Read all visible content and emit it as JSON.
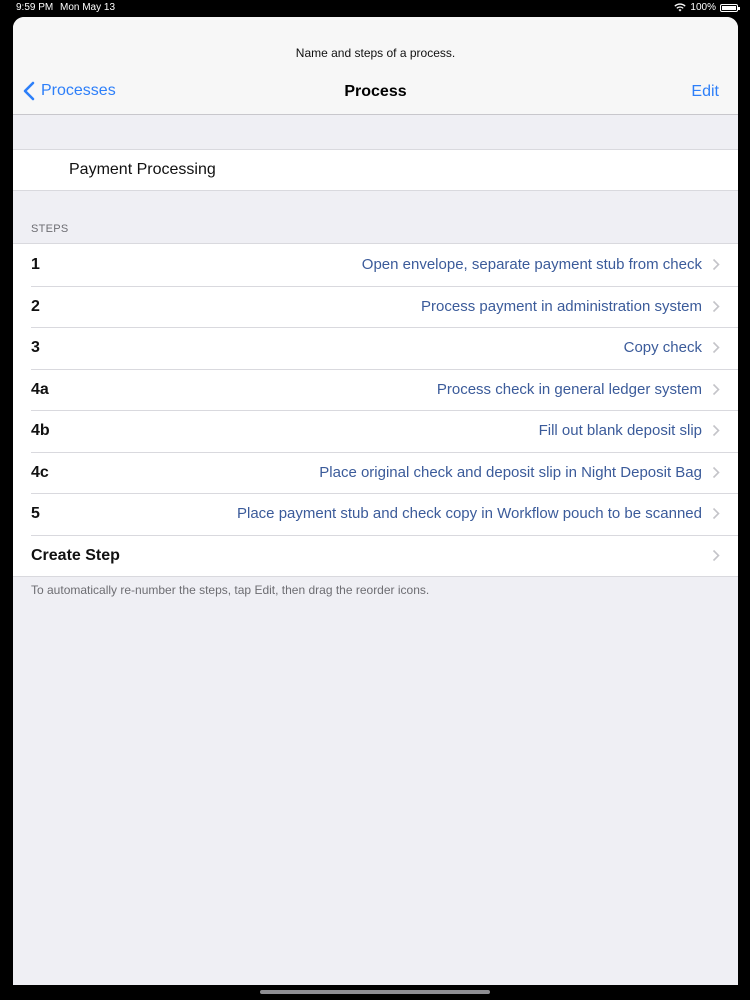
{
  "status_bar": {
    "time": "9:59 PM",
    "date": "Mon May 13",
    "battery": "100%"
  },
  "nav": {
    "prompt": "Name and steps of a process.",
    "back_label": "Processes",
    "title": "Process",
    "edit_label": "Edit"
  },
  "process_name": "Payment Processing",
  "steps_header": "STEPS",
  "steps": [
    {
      "number": "1",
      "description": "Open envelope, separate payment stub from check"
    },
    {
      "number": "2",
      "description": "Process payment in administration system"
    },
    {
      "number": "3",
      "description": "Copy check"
    },
    {
      "number": "4a",
      "description": "Process check in general ledger system"
    },
    {
      "number": "4b",
      "description": "Fill out blank deposit slip"
    },
    {
      "number": "4c",
      "description": "Place original check and deposit slip in Night Deposit Bag"
    },
    {
      "number": "5",
      "description": "Place payment stub and check copy in Workflow pouch to be scanned"
    },
    {
      "number": "Create Step",
      "description": ""
    }
  ],
  "footer_note": "To automatically re-number the steps, tap Edit, then drag the reorder icons.",
  "colors": {
    "accent": "#2d7ff9",
    "step_text": "#3b5b9a",
    "background": "#efeff4"
  },
  "icons": {
    "back": "chevron-left-icon",
    "row": "chevron-right-icon",
    "wifi": "wifi-icon",
    "battery": "battery-icon"
  }
}
